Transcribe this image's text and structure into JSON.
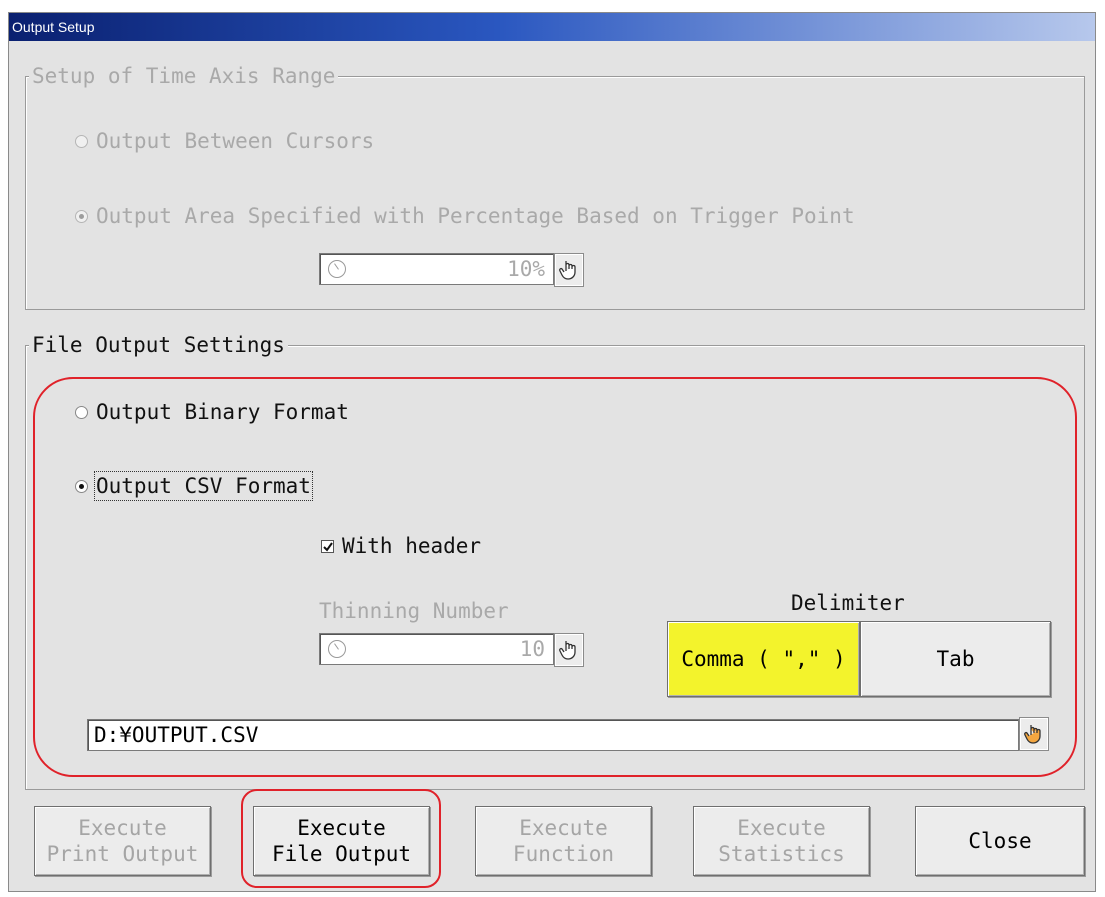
{
  "window": {
    "title": "Output Setup"
  },
  "time_axis": {
    "legend": "Setup of Time Axis Range",
    "option_cursors": "Output Between Cursors",
    "option_percentage": "Output Area Specified with Percentage Based on Trigger Point",
    "percentage_value": "10%"
  },
  "file_output": {
    "legend": "File Output Settings",
    "option_binary": "Output Binary Format",
    "option_csv": "Output CSV Format",
    "with_header_label": "With header",
    "with_header_checked": true,
    "thinning_label": "Thinning Number",
    "thinning_value": "10",
    "delimiter_label": "Delimiter",
    "delimiter_comma": "Comma ( \",\" )",
    "delimiter_tab": "Tab",
    "selected_delimiter_color": "#f3f32c",
    "path": "D:¥OUTPUT.CSV"
  },
  "buttons": {
    "print_output": "Execute\nPrint Output",
    "file_output": "Execute\nFile Output",
    "function": "Execute\nFunction",
    "statistics": "Execute\nStatistics",
    "close": "Close"
  },
  "icons": {
    "spin": "dial-icon",
    "hand": "hand-pointer-icon"
  },
  "colors": {
    "highlight": "#e0222a",
    "title_bar": "#0a2070"
  }
}
